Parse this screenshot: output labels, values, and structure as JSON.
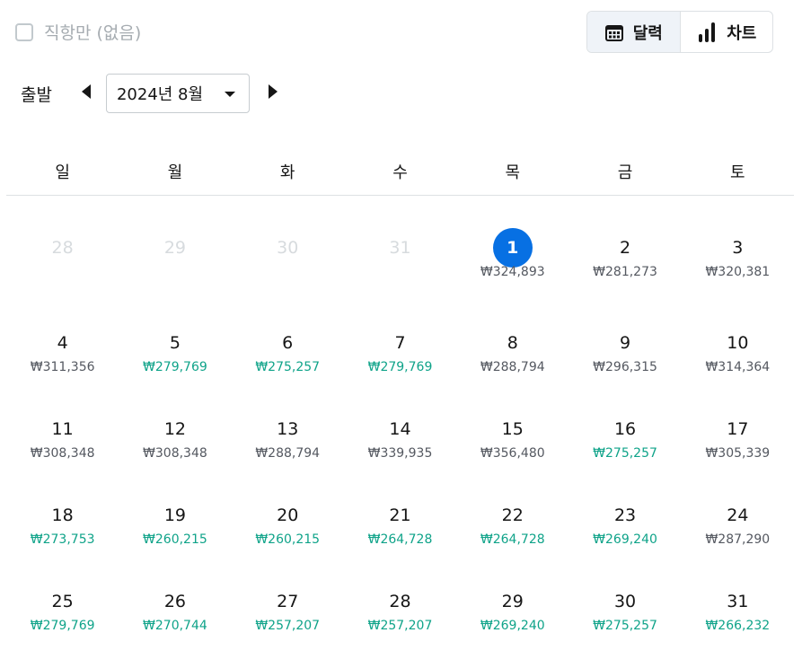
{
  "direct_only": {
    "label": "직항만 (없음)",
    "checked": false
  },
  "view_toggle": {
    "calendar": {
      "label": "달력",
      "icon": "calendar-icon",
      "active": true
    },
    "chart": {
      "label": "차트",
      "icon": "bar-chart-icon",
      "active": false
    }
  },
  "depart": {
    "label": "출발",
    "month": "2024년 8월"
  },
  "weekdays": [
    "일",
    "월",
    "화",
    "수",
    "목",
    "금",
    "토"
  ],
  "colors": {
    "accent": "#0770e3",
    "cheap": "#0fa389",
    "normal": "#545860",
    "outside": "#d7dbde"
  },
  "weeks": [
    [
      {
        "day": "28",
        "price": "",
        "outside": true
      },
      {
        "day": "29",
        "price": "",
        "outside": true
      },
      {
        "day": "30",
        "price": "",
        "outside": true
      },
      {
        "day": "31",
        "price": "",
        "outside": true
      },
      {
        "day": "1",
        "price": "₩324,893",
        "selected": true
      },
      {
        "day": "2",
        "price": "₩281,273"
      },
      {
        "day": "3",
        "price": "₩320,381"
      }
    ],
    [
      {
        "day": "4",
        "price": "₩311,356"
      },
      {
        "day": "5",
        "price": "₩279,769",
        "cheap": true
      },
      {
        "day": "6",
        "price": "₩275,257",
        "cheap": true
      },
      {
        "day": "7",
        "price": "₩279,769",
        "cheap": true
      },
      {
        "day": "8",
        "price": "₩288,794"
      },
      {
        "day": "9",
        "price": "₩296,315"
      },
      {
        "day": "10",
        "price": "₩314,364"
      }
    ],
    [
      {
        "day": "11",
        "price": "₩308,348"
      },
      {
        "day": "12",
        "price": "₩308,348"
      },
      {
        "day": "13",
        "price": "₩288,794"
      },
      {
        "day": "14",
        "price": "₩339,935"
      },
      {
        "day": "15",
        "price": "₩356,480"
      },
      {
        "day": "16",
        "price": "₩275,257",
        "cheap": true
      },
      {
        "day": "17",
        "price": "₩305,339"
      }
    ],
    [
      {
        "day": "18",
        "price": "₩273,753",
        "cheap": true
      },
      {
        "day": "19",
        "price": "₩260,215",
        "cheap": true
      },
      {
        "day": "20",
        "price": "₩260,215",
        "cheap": true
      },
      {
        "day": "21",
        "price": "₩264,728",
        "cheap": true
      },
      {
        "day": "22",
        "price": "₩264,728",
        "cheap": true
      },
      {
        "day": "23",
        "price": "₩269,240",
        "cheap": true
      },
      {
        "day": "24",
        "price": "₩287,290"
      }
    ],
    [
      {
        "day": "25",
        "price": "₩279,769",
        "cheap": true
      },
      {
        "day": "26",
        "price": "₩270,744",
        "cheap": true
      },
      {
        "day": "27",
        "price": "₩257,207",
        "cheap": true
      },
      {
        "day": "28",
        "price": "₩257,207",
        "cheap": true
      },
      {
        "day": "29",
        "price": "₩269,240",
        "cheap": true
      },
      {
        "day": "30",
        "price": "₩275,257",
        "cheap": true
      },
      {
        "day": "31",
        "price": "₩266,232",
        "cheap": true
      }
    ]
  ]
}
